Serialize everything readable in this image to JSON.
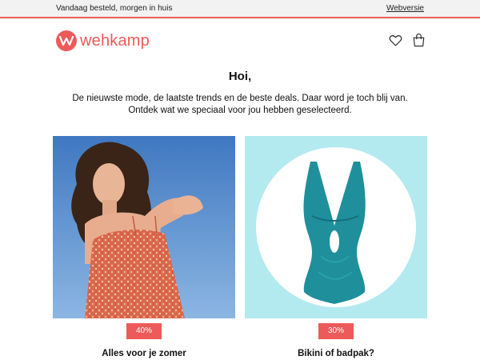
{
  "topbar": {
    "shipping_text": "Vandaag besteld, morgen in huis",
    "webversion_link": "Webversie"
  },
  "brand": {
    "name": "wehkamp",
    "accent_color": "#ec5a59"
  },
  "header": {
    "icons": [
      "heart-icon",
      "shopping-bag-icon"
    ]
  },
  "greeting": {
    "title": "Hoi,",
    "line1": "De nieuwste mode, de laatste trends en de beste deals. Daar word je toch blij van.",
    "line2": "Ontdek wat we speciaal voor jou hebben geselecteerd."
  },
  "promos": [
    {
      "discount": "40%",
      "caption": "Alles voor je zomer"
    },
    {
      "discount": "30%",
      "caption": "Bikini of badpak?"
    }
  ]
}
